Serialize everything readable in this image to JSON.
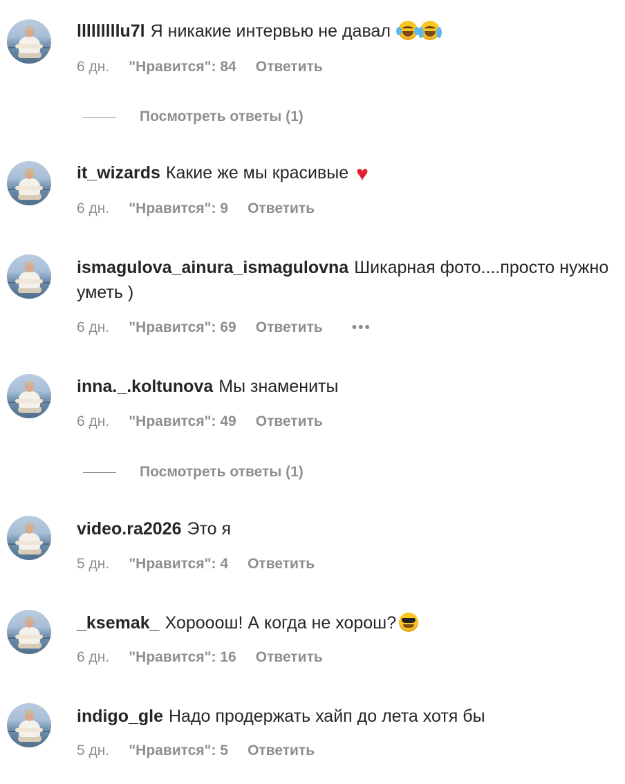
{
  "comments": [
    {
      "username": "lllllllllu7l",
      "text": "Я никакие интервью не давал",
      "emoji": [
        "face-with-tears-of-joy-icon",
        "loudly-crying-face-icon"
      ],
      "time": "6 дн.",
      "likes": "\"Нравится\": 84",
      "reply": "Ответить",
      "view_replies": "Посмотреть ответы (1)"
    },
    {
      "username": "it_wizards",
      "text": "Какие же мы красивые",
      "emoji": [
        "red-heart-icon"
      ],
      "time": "6 дн.",
      "likes": "\"Нравится\": 9",
      "reply": "Ответить"
    },
    {
      "username": "ismagulova_ainura_ismagulovna",
      "text": "Шикарная фото....просто нужно уметь )",
      "time": "6 дн.",
      "likes": "\"Нравится\": 69",
      "reply": "Ответить",
      "more": "•••"
    },
    {
      "username": "inna._.koltunova",
      "text": "Мы знамениты",
      "time": "6 дн.",
      "likes": "\"Нравится\": 49",
      "reply": "Ответить",
      "view_replies": "Посмотреть ответы (1)"
    },
    {
      "username": "video.ra2026",
      "text": "Это я",
      "time": "5 дн.",
      "likes": "\"Нравится\": 4",
      "reply": "Ответить"
    },
    {
      "username": "_ksemak_",
      "text": "Хорооош! А когда не хорош?",
      "emoji": [
        "smiling-face-with-sunglasses-icon"
      ],
      "time": "6 дн.",
      "likes": "\"Нравится\": 16",
      "reply": "Ответить"
    },
    {
      "username": "indigo_gle",
      "text": "Надо продержать хайп до лета хотя бы",
      "time": "5 дн.",
      "likes": "\"Нравится\": 5",
      "reply": "Ответить"
    }
  ]
}
